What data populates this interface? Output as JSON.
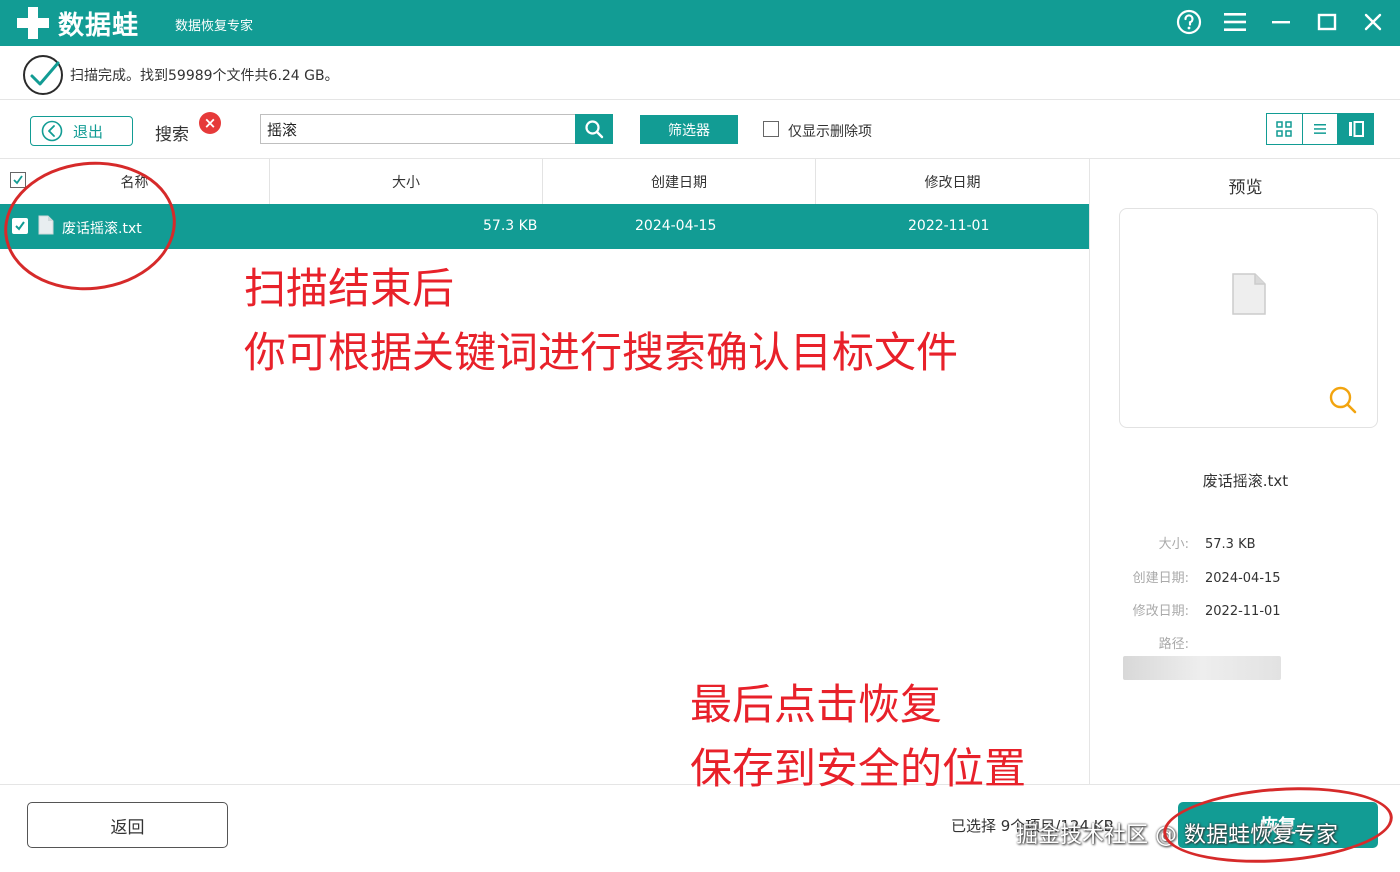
{
  "app": {
    "brand": "数据蛙",
    "subtitle": "数据恢复专家"
  },
  "status": {
    "text": "扫描完成。找到59989个文件共6.24 GB。"
  },
  "toolbar": {
    "exit_label": "退出",
    "search_label": "搜索",
    "search_value": "摇滚",
    "filter_label": "筛选器",
    "deleted_only_label": "仅显示删除项"
  },
  "table": {
    "columns": [
      "名称",
      "大小",
      "创建日期",
      "修改日期"
    ],
    "rows": [
      {
        "name": "废话摇滚.txt",
        "size": "57.3 KB",
        "created": "2024-04-15",
        "modified": "2022-11-01",
        "checked": true
      }
    ]
  },
  "preview": {
    "title": "预览",
    "filename": "废话摇滚.txt",
    "size_label": "大小:",
    "size_value": "57.3 KB",
    "created_label": "创建日期:",
    "created_value": "2024-04-15",
    "modified_label": "修改日期:",
    "modified_value": "2022-11-01",
    "path_label": "路径:"
  },
  "bottom": {
    "back_label": "返回",
    "selected_info": "已选择 9个项目/124 KB",
    "recover_label": "恢复"
  },
  "annotations": {
    "line1": "扫描结束后",
    "line2": "你可根据关键词进行搜索确认目标文件",
    "line3": "最后点击恢复",
    "line4": "保存到安全的位置"
  },
  "watermark": "掘金技术社区 @ 数据蛙恢复专家",
  "colors": {
    "accent": "#129c94",
    "annotation": "#e8212a",
    "clear_badge": "#e63a3a"
  },
  "icons": [
    "app-logo-icon",
    "help-icon",
    "menu-icon",
    "minimize-icon",
    "maximize-icon",
    "close-icon",
    "check-circle-icon",
    "back-arrow-icon",
    "clear-icon",
    "search-icon",
    "grid-view-icon",
    "list-view-icon",
    "detail-view-icon",
    "file-icon",
    "zoom-icon"
  ]
}
